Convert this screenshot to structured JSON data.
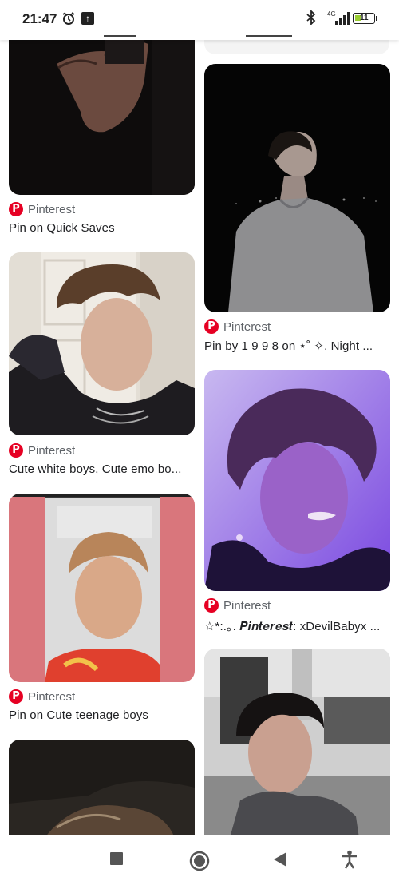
{
  "status_bar": {
    "time": "21:47",
    "network": "4G",
    "battery": "11"
  },
  "cards_left": [
    {
      "source": "Pinterest",
      "title": "Pin on Quick Saves"
    },
    {
      "source": "Pinterest",
      "title": "Cute white boys, Cute emo bo..."
    },
    {
      "source": "Pinterest",
      "title": "Pin on Cute teenage boys"
    }
  ],
  "cards_right": [
    {
      "source": "Pinterest",
      "title": "Pin by 1 9 9 8 on ⋆˚ ✧. Night ..."
    },
    {
      "source": "Pinterest",
      "title": "☆*:.｡. 𝑷𝒊𝒏𝒕𝒆𝒓𝒆𝒔𝒕: xDevilBabyx ..."
    }
  ],
  "icons": {
    "source_logo": "P",
    "alarm": "⏰",
    "upload": "↑",
    "bluetooth": "✱",
    "nav_recents": "■",
    "nav_home": "◉",
    "nav_back": "◀",
    "nav_accessibility": "♿"
  }
}
